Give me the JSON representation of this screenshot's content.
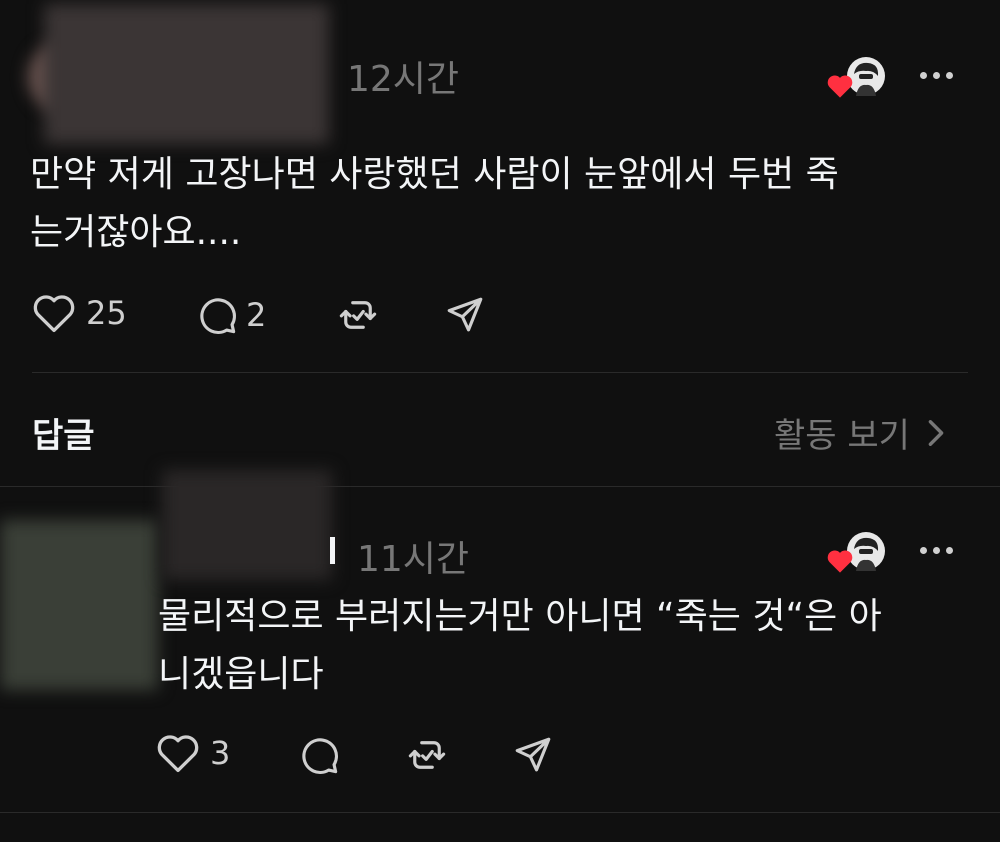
{
  "post": {
    "time": "12시간",
    "text": "만약 저게 고장나면 사랑했던 사람이 눈앞에서 두번 죽\n는거잖아요....",
    "likes": "25",
    "comments": "2"
  },
  "replies_section": {
    "title": "답글",
    "activity_link": "활동 보기"
  },
  "reply": {
    "time": "11시간",
    "text": "물리적으로 부러지는거만 아니면 “죽는 것“은 아\n니겠읍니다",
    "likes": "3"
  },
  "colors": {
    "background": "#101010",
    "text": "#f3f5f7",
    "muted": "#777777",
    "heart": "#ff3040"
  },
  "icons": [
    "heart-icon",
    "comment-icon",
    "repost-icon",
    "share-icon",
    "more-icon",
    "chevron-right-icon"
  ]
}
